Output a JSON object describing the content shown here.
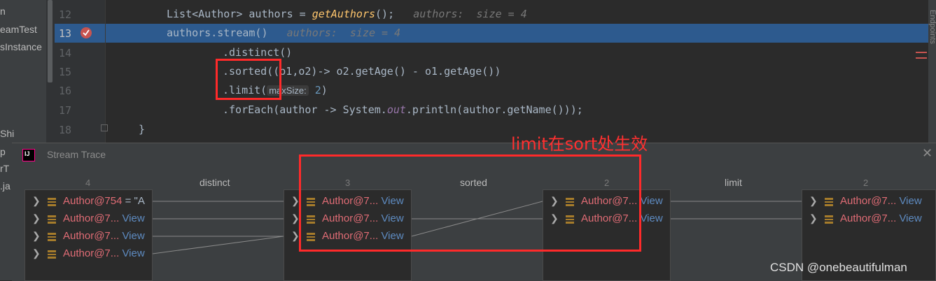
{
  "project_tree": {
    "labels": [
      "n",
      "eamTest",
      "sInstance",
      "Shi",
      "p",
      "rT",
      ".ja"
    ]
  },
  "editor": {
    "lines": [
      {
        "num": "12",
        "parts": [
          {
            "t": "List<Author> authors = ",
            "c": ""
          },
          {
            "t": "getAuthors",
            "c": "it fn"
          },
          {
            "t": "();",
            "c": ""
          },
          {
            "t": "   authors:  size = 4",
            "c": "hint"
          }
        ]
      },
      {
        "num": "13",
        "parts": [
          {
            "t": "authors.stream()",
            "c": ""
          },
          {
            "t": "   authors:  size = 4",
            "c": "hint"
          }
        ]
      },
      {
        "num": "14",
        "parts": [
          {
            "t": ".distinct()",
            "c": ""
          }
        ]
      },
      {
        "num": "15",
        "parts": [
          {
            "t": ".sorted((o1,o2)-> o2.getAge() - o1.getAge())",
            "c": ""
          }
        ]
      },
      {
        "num": "16",
        "parts": [
          {
            "t": ".limit(",
            "c": ""
          },
          {
            "t": "maxSize:",
            "c": "pbox"
          },
          {
            "t": " 2",
            "c": "num"
          },
          {
            "t": ")",
            "c": ""
          }
        ]
      },
      {
        "num": "17",
        "parts": [
          {
            "t": ".forEach(author -> System.",
            "c": ""
          },
          {
            "t": "out",
            "c": "st"
          },
          {
            "t": ".println(author.getName()));",
            "c": ""
          }
        ]
      },
      {
        "num": "18",
        "parts": [
          {
            "t": "}",
            "c": ""
          }
        ]
      }
    ],
    "right_tab": "Endpoints"
  },
  "stream_trace": {
    "title": "Stream Trace",
    "operations": [
      "distinct",
      "sorted",
      "limit"
    ],
    "columns": [
      {
        "count": "4",
        "rows": [
          {
            "name": "Author@754",
            "suffix": " = \"A",
            "view": ""
          },
          {
            "name": "Author@7...",
            "suffix": "",
            "view": " View"
          },
          {
            "name": "Author@7...",
            "suffix": "",
            "view": " View"
          },
          {
            "name": "Author@7...",
            "suffix": "",
            "view": " View"
          }
        ]
      },
      {
        "count": "3",
        "rows": [
          {
            "name": "Author@7...",
            "suffix": "",
            "view": " View"
          },
          {
            "name": "Author@7...",
            "suffix": "",
            "view": " View"
          },
          {
            "name": "Author@7...",
            "suffix": "",
            "view": " View"
          }
        ]
      },
      {
        "count": "2",
        "rows": [
          {
            "name": "Author@7...",
            "suffix": "",
            "view": " View"
          },
          {
            "name": "Author@7...",
            "suffix": "",
            "view": " View"
          }
        ]
      },
      {
        "count": "2",
        "rows": [
          {
            "name": "Author@7...",
            "suffix": "",
            "view": " View"
          },
          {
            "name": "Author@7...",
            "suffix": "",
            "view": " View"
          }
        ]
      }
    ]
  },
  "annotation": {
    "text": "limit在sort处生效"
  },
  "watermark": "CSDN @onebeautifulman",
  "colors": {
    "editor_bg": "#2b2b2b",
    "current_line": "#2d5a8e",
    "object_name": "#e06c75",
    "view_link": "#5e8bc1",
    "annotation_red": "#ff2a2a"
  }
}
